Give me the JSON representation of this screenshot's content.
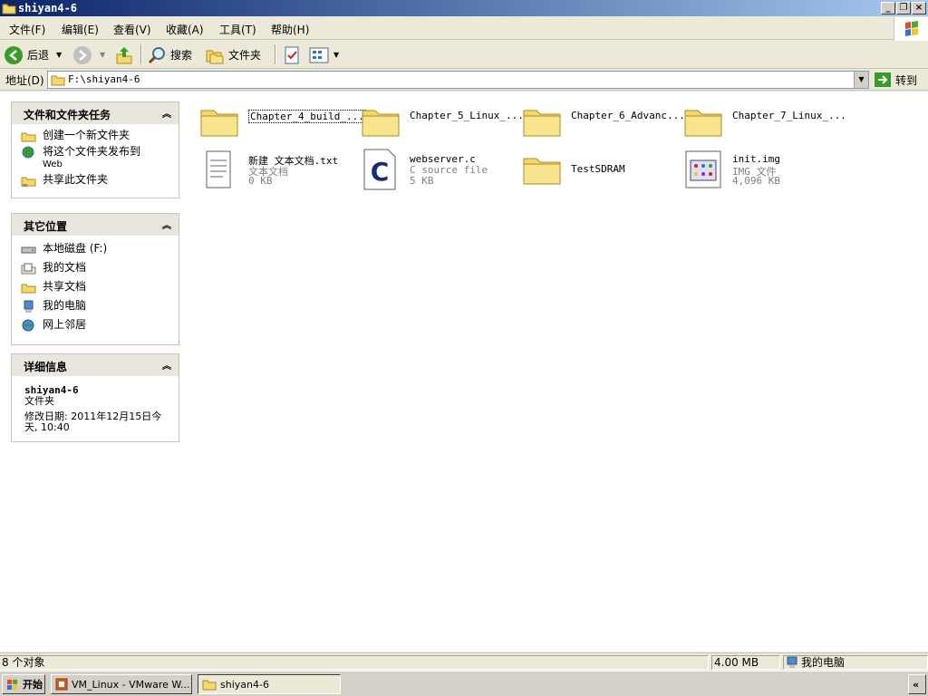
{
  "window": {
    "title": "shiyan4-6"
  },
  "menubar": {
    "items": [
      "文件(F)",
      "编辑(E)",
      "查看(V)",
      "收藏(A)",
      "工具(T)",
      "帮助(H)"
    ]
  },
  "toolbar": {
    "back_label": "后退",
    "search_label": "搜索",
    "folders_label": "文件夹"
  },
  "address": {
    "label": "地址(D)",
    "value": "F:\\shiyan4-6",
    "go_label": "转到"
  },
  "tasks_panel": {
    "title": "文件和文件夹任务",
    "items": [
      "创建一个新文件夹",
      "将这个文件夹发布到",
      "Web",
      "共享此文件夹"
    ]
  },
  "places_panel": {
    "title": "其它位置",
    "items": [
      "本地磁盘 (F:)",
      "我的文档",
      "共享文档",
      "我的电脑",
      "网上邻居"
    ]
  },
  "details_panel": {
    "title": "详细信息",
    "name": "shiyan4-6",
    "type": "文件夹",
    "modified": "修改日期: 2011年12月15日今",
    "modified2": "天, 10:40"
  },
  "files": [
    {
      "name": "Chapter_4_build_...",
      "icon": "folder"
    },
    {
      "name": "Chapter_5_Linux_...",
      "icon": "folder"
    },
    {
      "name": "Chapter_6_Advanc...",
      "icon": "folder"
    },
    {
      "name": "Chapter_7_Linux_...",
      "icon": "folder"
    },
    {
      "name": "新建 文本文档.txt",
      "type": "文本文档",
      "size": "0 KB",
      "icon": "text-file"
    },
    {
      "name": "webserver.c",
      "type": "C source file",
      "size": "5 KB",
      "icon": "c-file"
    },
    {
      "name": "TestSDRAM",
      "icon": "folder"
    },
    {
      "name": "init.img",
      "type": "IMG 文件",
      "size": "4,096 KB",
      "icon": "img-file"
    }
  ],
  "statusbar": {
    "objects": "8 个对象",
    "size": "4.00 MB",
    "location": "我的电脑"
  },
  "taskbar": {
    "start": "开始",
    "tasks": [
      "VM_Linux - VMware W...",
      "shiyan4-6"
    ],
    "chevron": "«"
  },
  "colors": {
    "title_start": "#0a246a",
    "title_end": "#a6caf0",
    "folder": "#f5d86b",
    "accent_green": "#3a9a2a"
  }
}
